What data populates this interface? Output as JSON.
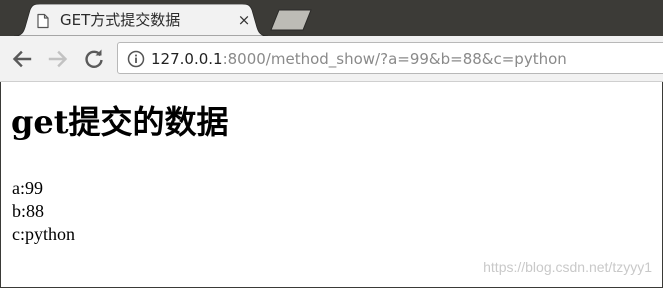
{
  "browser": {
    "tab": {
      "title": "GET方式提交数据",
      "close_glyph": "×"
    },
    "icons": {
      "tab_page": "page-icon",
      "new_tab": "new-tab-icon",
      "back": "back-arrow-icon",
      "forward": "forward-arrow-icon",
      "reload": "reload-icon",
      "site_info": "info-icon"
    },
    "address_bar": {
      "host": "127.0.0.1",
      "rest": ":8000/method_show/?a=99&b=88&c=python"
    }
  },
  "page": {
    "heading": "get提交的数据",
    "lines": [
      "a:99",
      "b:88",
      "c:python"
    ],
    "watermark": "https://blog.csdn.net/tzyyy1"
  },
  "colors": {
    "tabstrip": "#3c3b37",
    "active_tab": "#f2f2f2",
    "toolbar": "#f2f2f2",
    "page_background": "#ffffff"
  }
}
